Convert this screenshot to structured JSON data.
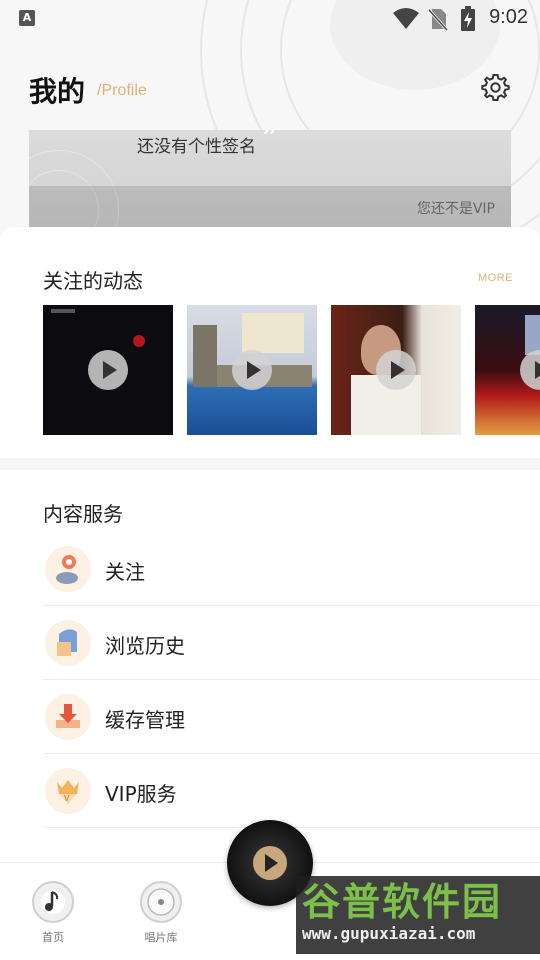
{
  "status_bar": {
    "app_badge": "A",
    "time": "9:02",
    "icons": [
      "wifi-icon",
      "no-sim-icon",
      "battery-charging-icon"
    ]
  },
  "header": {
    "title": "我的",
    "subtitle": "/Profile",
    "settings_icon": "gear-icon"
  },
  "profile_card": {
    "signature": "还没有个性签名",
    "vip_status": "您还不是VIP"
  },
  "following": {
    "title": "关注的动态",
    "more_label": "MORE",
    "items": [
      {
        "cover_icon": "album-cover-dark-red-dot",
        "play_icon": "play-icon"
      },
      {
        "cover_icon": "album-cover-london-suite",
        "play_icon": "play-icon"
      },
      {
        "cover_icon": "album-cover-portrait",
        "play_icon": "play-icon"
      },
      {
        "cover_icon": "album-cover-red-stage",
        "play_icon": "play-icon"
      }
    ]
  },
  "services": {
    "title": "内容服务",
    "items": [
      {
        "label": "关注",
        "icon": "follow-icon"
      },
      {
        "label": "浏览历史",
        "icon": "history-icon"
      },
      {
        "label": "缓存管理",
        "icon": "download-icon"
      },
      {
        "label": "VIP服务",
        "icon": "vip-crown-icon"
      }
    ]
  },
  "bottom_nav": {
    "items": [
      {
        "label": "首页",
        "icon": "music-note-icon"
      },
      {
        "label": "唱片库",
        "icon": "vinyl-record-icon"
      }
    ],
    "player_icon": "play-icon"
  },
  "watermark": {
    "title": "谷普软件园",
    "url": "www.gupuxiazai.com"
  },
  "colors": {
    "accent": "#e2b07a",
    "service_icon_bg": "#fdf1e4"
  }
}
